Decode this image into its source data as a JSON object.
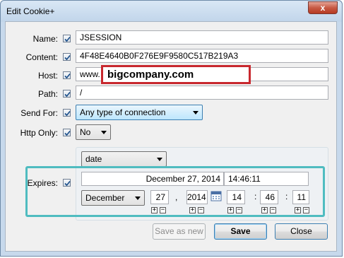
{
  "window": {
    "title": "Edit Cookie+",
    "close_glyph": "x"
  },
  "fields": {
    "name": {
      "label": "Name:",
      "value": "JSESSION"
    },
    "content": {
      "label": "Content:",
      "value": "4F48E4640B0F276E9F9580C517B219A3"
    },
    "host": {
      "label": "Host:",
      "prefix": "www.",
      "value": "bigcompany.com"
    },
    "path": {
      "label": "Path:",
      "value": "/"
    },
    "send_for": {
      "label": "Send For:",
      "value": "Any type of connection"
    },
    "http_only": {
      "label": "Http Only:",
      "value": "No"
    }
  },
  "expires": {
    "label": "Expires:",
    "mode": "date",
    "date_text": "December 27, 2014",
    "time_text": "14:46:11",
    "month": "December",
    "day": "27",
    "day_sep": ",",
    "year": "2014",
    "hour": "14",
    "minute": "46",
    "second": "11",
    "time_sep": ":",
    "plus": "+",
    "minus": "−"
  },
  "buttons": {
    "save_as_new": "Save as new",
    "save": "Save",
    "close": "Close"
  },
  "icons": {
    "checkbox": "checkmark-icon",
    "calendar": "calendar-icon"
  },
  "colors": {
    "highlight_red": "#c8282e",
    "highlight_teal": "#4fbcc0",
    "close_red": "#c75a45"
  }
}
